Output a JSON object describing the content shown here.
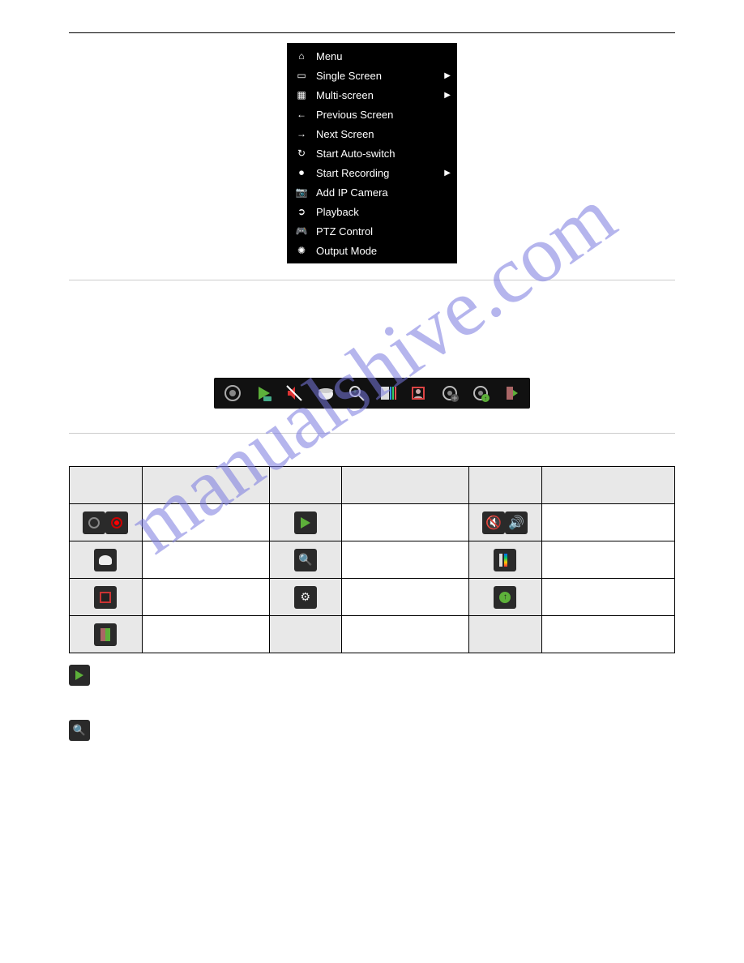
{
  "watermark": "manualshive.com",
  "context_menu": {
    "items": [
      {
        "label": "Menu",
        "icon": "home-icon",
        "has_submenu": false
      },
      {
        "label": "Single Screen",
        "icon": "monitor-icon",
        "has_submenu": true
      },
      {
        "label": "Multi-screen",
        "icon": "grid-icon",
        "has_submenu": true
      },
      {
        "label": "Previous Screen",
        "icon": "arrow-left-icon",
        "has_submenu": false
      },
      {
        "label": "Next Screen",
        "icon": "arrow-right-icon",
        "has_submenu": false
      },
      {
        "label": "Start Auto-switch",
        "icon": "refresh-icon",
        "has_submenu": false
      },
      {
        "label": "Start Recording",
        "icon": "record-icon",
        "has_submenu": true
      },
      {
        "label": "Add IP Camera",
        "icon": "camera-icon",
        "has_submenu": false
      },
      {
        "label": "Playback",
        "icon": "play-icon",
        "has_submenu": false
      },
      {
        "label": "PTZ Control",
        "icon": "ptz-icon",
        "has_submenu": false
      },
      {
        "label": "Output Mode",
        "icon": "output-icon",
        "has_submenu": false
      }
    ]
  },
  "toolbar": {
    "icons": [
      "record-toggle-icon",
      "instant-playback-icon",
      "audio-mute-icon",
      "ptz-dome-icon",
      "digital-zoom-icon",
      "image-settings-icon",
      "face-detect-icon",
      "stream-settings-icon",
      "stream-info-icon",
      "close-icon"
    ]
  },
  "table": {
    "rows": [
      [
        "record-toggle-icon-pair",
        "",
        "instant-playback-icon",
        "",
        "audio-toggle-icon-pair",
        ""
      ],
      [
        "ptz-dome-icon",
        "",
        "digital-zoom-icon",
        "",
        "image-settings-icon",
        ""
      ],
      [
        "face-detect-icon",
        "",
        "stream-settings-icon",
        "",
        "stream-info-icon",
        ""
      ],
      [
        "close-icon",
        "",
        "",
        "",
        "",
        ""
      ]
    ]
  },
  "inline_icons": {
    "playback": "instant-playback-icon",
    "zoom": "digital-zoom-icon"
  }
}
